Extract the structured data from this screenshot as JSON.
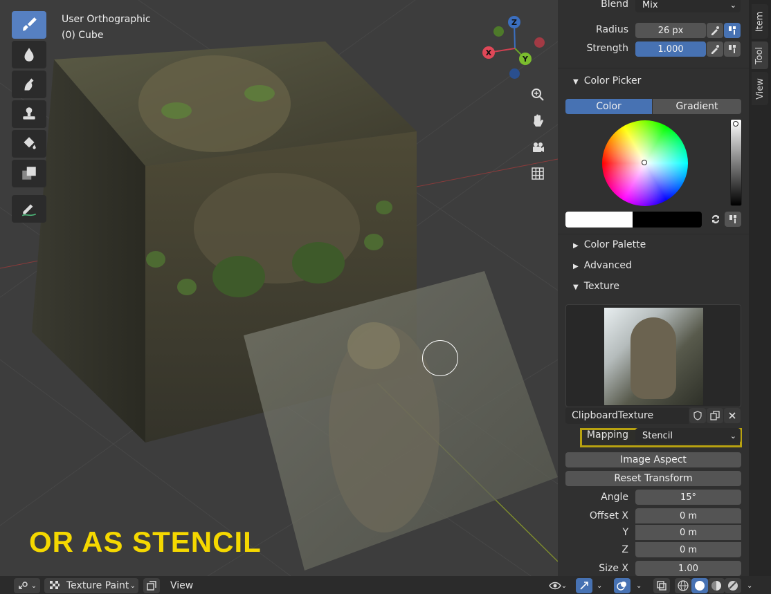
{
  "viewport": {
    "view_name": "User Orthographic",
    "object_name": "(0) Cube",
    "overlay_text": "OR AS STENCIL",
    "gizmo": {
      "x": "X",
      "y": "Y",
      "z": "Z"
    }
  },
  "tools": [
    "draw-tool",
    "soften-tool",
    "smear-tool",
    "clone-tool",
    "fill-tool",
    "mask-tool",
    "annotate-tool"
  ],
  "brush": {
    "blend_label": "Blend",
    "blend_value": "Mix",
    "radius_label": "Radius",
    "radius_value": "26 px",
    "strength_label": "Strength",
    "strength_value": "1.000"
  },
  "color_picker": {
    "section_label": "Color Picker",
    "tab_color": "Color",
    "tab_gradient": "Gradient",
    "primary_color": "#ffffff",
    "secondary_color": "#000000"
  },
  "sections": {
    "color_palette": "Color Palette",
    "advanced": "Advanced",
    "texture": "Texture"
  },
  "texture": {
    "name": "ClipboardTexture",
    "mapping_label": "Mapping",
    "mapping_value": "Stencil",
    "image_aspect_button": "Image Aspect",
    "reset_transform_button": "Reset Transform",
    "angle_label": "Angle",
    "angle_value": "15°",
    "offset_x_label": "Offset X",
    "offset_x_value": "0 m",
    "y_label": "Y",
    "y_value": "0 m",
    "z_label": "Z",
    "z_value": "0 m",
    "size_x_label": "Size X",
    "size_x_value": "1.00"
  },
  "side_tabs": [
    "Item",
    "Tool",
    "View"
  ],
  "header": {
    "mode_label": "Texture Paint",
    "view_menu": "View"
  },
  "colors": {
    "accent": "#4772b3",
    "overlay_text": "#f5d800",
    "highlight_border": "#b8a210"
  }
}
